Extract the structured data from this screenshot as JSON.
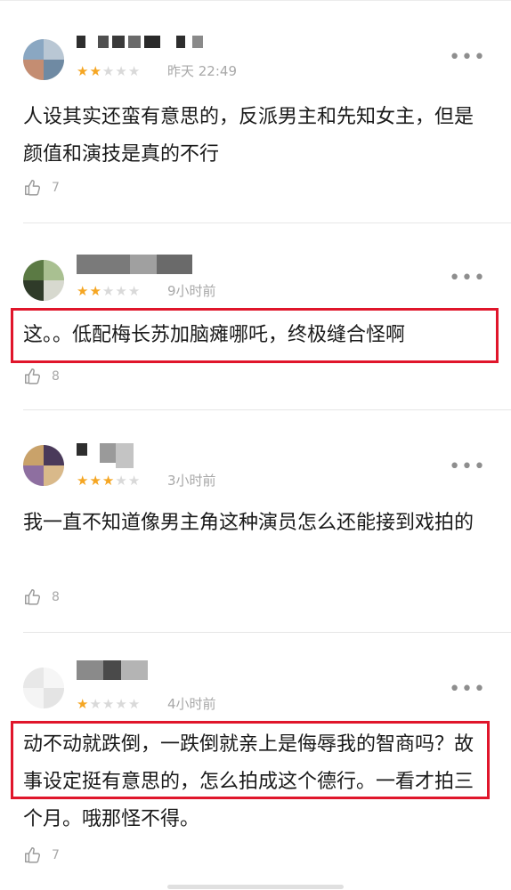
{
  "comments": [
    {
      "rating": 2,
      "max_rating": 5,
      "time": "昨天 22:49",
      "text": "人设其实还蛮有意思的，反派男主和先知女主，但是颜值和演技是真的不行",
      "likes": "7",
      "highlighted": false
    },
    {
      "rating": 2,
      "max_rating": 5,
      "time": "9小时前",
      "text": "这。。低配梅长苏加脑瘫哪吒，终极缝合怪啊",
      "likes": "8",
      "highlighted": true
    },
    {
      "rating": 3,
      "max_rating": 5,
      "time": "3小时前",
      "text": "我一直不知道像男主角这种演员怎么还能接到戏拍的",
      "likes": "8",
      "highlighted": false
    },
    {
      "rating": 1,
      "max_rating": 5,
      "time": "4小时前",
      "text": "动不动就跌倒，一跌倒就亲上是侮辱我的智商吗？故事设定挺有意思的，怎么拍成这个德行。一看才拍三个月。哦那怪不得。",
      "likes": "7",
      "highlighted": true
    }
  ],
  "icons": {
    "more": "more-icon",
    "like": "thumbs-up-icon",
    "star": "star-icon"
  },
  "colors": {
    "star_filled": "#f5a623",
    "star_empty": "#d9d9d9",
    "highlight_box": "#e0162b",
    "meta_text": "#a8a8a8"
  }
}
